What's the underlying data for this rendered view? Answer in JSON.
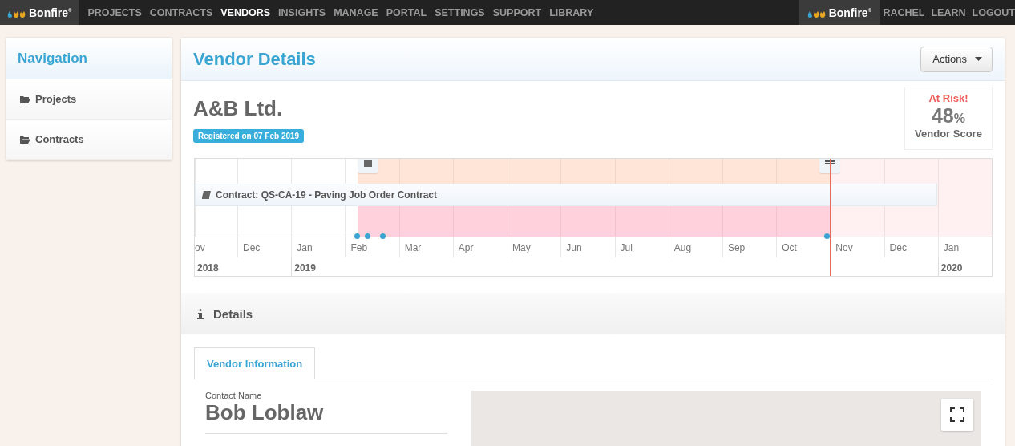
{
  "topbar": {
    "logo": "Bonfire$^{®}$",
    "menu": [
      {
        "label": "PROJECTS",
        "selected": false
      },
      {
        "label": "CONTRACTS",
        "selected": false
      },
      {
        "label": "VENDORS",
        "selected": true
      },
      {
        "label": "INSIGHTS",
        "selected": false
      },
      {
        "label": "MANAGE",
        "selected": false
      },
      {
        "label": "PORTAL",
        "selected": false
      },
      {
        "label": "SETTINGS",
        "selected": false
      },
      {
        "label": "SUPPORT",
        "selected": false
      },
      {
        "label": "LIBRARY",
        "selected": false
      }
    ],
    "right_logo": "Bonfire$^{®}$",
    "right_menu": [
      "RACHEL",
      "LEARN",
      "LOGOUT"
    ]
  },
  "sidebar": {
    "title": "Navigation",
    "items": [
      "Projects",
      "Contracts"
    ]
  },
  "main": {
    "title": "Vendor Details",
    "actions": "Actions",
    "vendor": "A&B Ltd.",
    "badge": "Registered on 07 Feb 2019",
    "score": {
      "status": "At Risk!",
      "value": "48",
      "unit": "%",
      "label": "Vendor Score"
    },
    "timeline": {
      "contract": "Contract: QS-CA-19 - Paving Job Order Contract",
      "months": [
        {
          "label": "ov",
          "year": "2018"
        },
        {
          "label": "Dec"
        },
        {
          "label": "Jan",
          "year": "2019"
        },
        {
          "label": "Feb"
        },
        {
          "label": "Mar"
        },
        {
          "label": "Apr"
        },
        {
          "label": "May"
        },
        {
          "label": "Jun"
        },
        {
          "label": "Jul"
        },
        {
          "label": "Aug"
        },
        {
          "label": "Sep"
        },
        {
          "label": "Oct"
        },
        {
          "label": "Nov"
        },
        {
          "label": "Dec"
        },
        {
          "label": "Jan",
          "year": "2020"
        }
      ]
    },
    "details": {
      "title": "Details",
      "tabs": [
        {
          "label": "Vendor Information",
          "selected": true
        }
      ],
      "contact_label": "Contact Name",
      "contact_name": "Bob Loblaw"
    }
  }
}
